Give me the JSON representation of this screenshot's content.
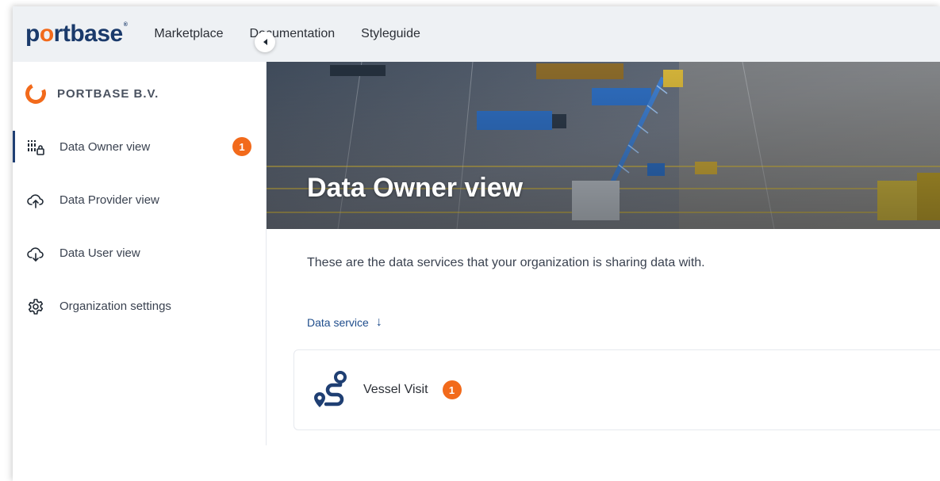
{
  "header": {
    "logo_text_pre": "p",
    "logo_text_o": "o",
    "logo_text_post": "rtbase",
    "logo_mark": "®",
    "nav": [
      "Marketplace",
      "Documentation",
      "Styleguide"
    ]
  },
  "sidebar": {
    "org_name": "PORTBASE B.V.",
    "items": [
      {
        "label": "Data Owner view",
        "icon": "data-owner-icon",
        "badge": "1",
        "active": true
      },
      {
        "label": "Data Provider view",
        "icon": "cloud-upload-icon"
      },
      {
        "label": "Data User view",
        "icon": "cloud-download-icon"
      },
      {
        "label": "Organization settings",
        "icon": "gear-icon"
      }
    ]
  },
  "hero": {
    "title": "Data Owner view"
  },
  "main": {
    "intro": "These are the data services that your organization is sharing data with.",
    "sort_label": "Data service",
    "sort_arrow": "↓",
    "services": [
      {
        "name": "Vessel Visit",
        "badge": "1",
        "icon": "route-icon"
      }
    ]
  },
  "colors": {
    "accent": "#f26a1b",
    "brand": "#1a3a6b",
    "link": "#1f4d8c"
  }
}
